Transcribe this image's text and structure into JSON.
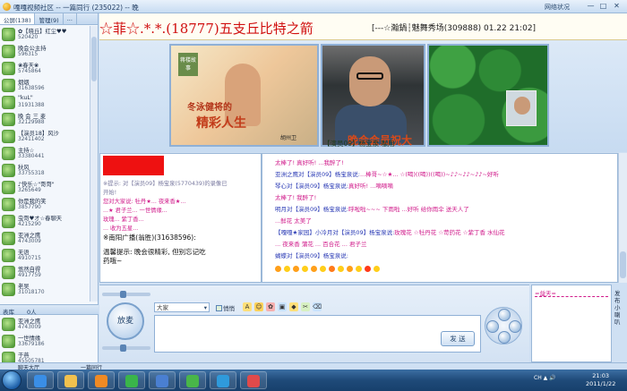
{
  "window": {
    "title": "嘎嘎视频社区 -- 一篇同行 (235022) -- 晚",
    "net_label": "网络状况",
    "min": "—",
    "max": "□",
    "close": "✕"
  },
  "left": {
    "tabs": [
      "公屏(138)",
      "管理(9)",
      "..."
    ],
    "users": [
      {
        "name": "✿【晓丘】红尘♥♥",
        "id": "520420"
      },
      {
        "name": "晚会公主持",
        "id": "596315"
      },
      {
        "name": "❀春天❀",
        "id": "5745864"
      },
      {
        "name": "烟烟",
        "id": "31638596"
      },
      {
        "name": "\"kuL\"",
        "id": "31931388"
      },
      {
        "name": "晚 会 三 麦",
        "id": "32129988"
      },
      {
        "name": "【演员18】风沙",
        "id": "32411402"
      },
      {
        "name": "主持☆",
        "id": "33380441"
      },
      {
        "name": "秋风",
        "id": "33755318"
      },
      {
        "name": "♪快乐☆\"哥哥\"",
        "id": "3265649"
      },
      {
        "name": "你是我的笑",
        "id": "3857790"
      },
      {
        "name": "虫哥♥オ☆春聊天",
        "id": "4215290"
      },
      {
        "name": "亚洲之鹰",
        "id": "4743009"
      },
      {
        "name": "无语",
        "id": "4910715"
      },
      {
        "name": "悠然自得",
        "id": "4917759"
      },
      {
        "name": "老吴",
        "id": "31018170"
      }
    ],
    "tabs2": [
      "表库",
      "0人"
    ],
    "users2": [
      {
        "name": "亚洲之鹰",
        "id": "4743009"
      },
      {
        "name": "一世情缘",
        "id": "33679186"
      },
      {
        "name": "于燕",
        "id": "45505781"
      }
    ]
  },
  "banner": {
    "line1": "☆菲☆.*.*.(18777)五支丘比特之箭",
    "line2": "[---☆瀚鍋┆魅舞秀场(309888) 01.22 21:02]"
  },
  "videos": {
    "v1_tag": "蒋楼故事",
    "v1_cap": "冬泳健将的",
    "v1_cap2": "精彩人生",
    "v1_logo": "胡州卫",
    "caption_big": "晚会会员祝大",
    "caption_small": "【演员09】杨宝泉  咖用"
  },
  "chat_left": [
    "※提示: 对【演员09】杨宝泉(5770439)的录像已",
    "开始!",
    "您对大家说: 牡丹★... 夜来香★...",
    "...★ 君子兰... 一世情缘...",
    "玫瑰... 紫丁香...",
    "... 收为五星...",
    "※南阳广播(翁胜)(31638596):",
    "温馨提示: 晚会很精彩, 但别忘记吃",
    "药哦~"
  ],
  "chat_right": [
    {
      "who": "",
      "text": "太棒了! 真好听!   ...我醉了!"
    },
    {
      "who": "亚洲之鹰对【演员09】杨宝泉说:",
      "text": "...棒哥~☆★... ☆(喝)((喝))((喝))~♪♪~♪♪~♪♪~好听"
    },
    {
      "who": "琴心对【演员09】杨宝泉说:",
      "text": "真好听!   ...嘀嘀嘀"
    },
    {
      "who": "",
      "text": "太棒了! 我醉了!"
    },
    {
      "who": "明月对【演员09】杨宝泉说:",
      "text": "呼啦啦~~~ 下雨啦 ...好听 给你雨伞 送天人了"
    },
    {
      "who": "",
      "text": "...鲜花 太美了"
    },
    {
      "who": "【嘎嘎★家园】小冷月对【演员09】杨宝泉说:",
      "text": "玫瑰花 ☆牡丹花 ☆苛药花 ☆紫丁香 水仙花"
    },
    {
      "who": "",
      "text": "... 夜来香 蒲花 ... 百合花 ... 君子兰"
    },
    {
      "who": "蝴蝶对【演员09】杨宝泉说:",
      "text": ""
    }
  ],
  "input": {
    "mic_label": "放麦",
    "target_label": "大家",
    "check_label": "悄悄",
    "send_label": "发 送"
  },
  "right_box": {
    "header": "=益天=",
    "vertical": "发布小喇叭"
  },
  "bottom_tabs": [
    "聊天大厅",
    "一篇同行"
  ],
  "taskbar": {
    "tray": "CH ▲ 🔊",
    "time": "21:03",
    "date": "2011/1/22"
  }
}
